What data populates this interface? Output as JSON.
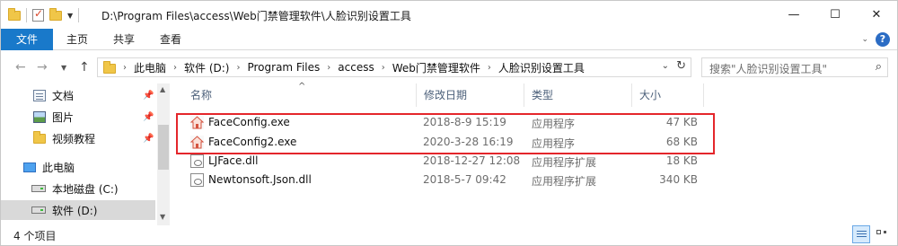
{
  "window": {
    "path_title": "D:\\Program Files\\access\\Web门禁管理软件\\人脸识别设置工具",
    "controls": {
      "minimize": "—",
      "maximize": "☐",
      "close": "✕"
    }
  },
  "ribbon": {
    "tabs": [
      "文件",
      "主页",
      "共享",
      "查看"
    ],
    "help": "?"
  },
  "address": {
    "crumbs": [
      "此电脑",
      "软件 (D:)",
      "Program Files",
      "access",
      "Web门禁管理软件",
      "人脸识别设置工具"
    ],
    "search_placeholder": "搜索\"人脸识别设置工具\""
  },
  "sidebar": {
    "items": [
      {
        "label": "文档",
        "icon": "document-icon",
        "pinned": true
      },
      {
        "label": "图片",
        "icon": "picture-icon",
        "pinned": true
      },
      {
        "label": "视频教程",
        "icon": "folder-icon",
        "pinned": true
      },
      {
        "label": "此电脑",
        "icon": "computer-icon",
        "pinned": false
      },
      {
        "label": "本地磁盘 (C:)",
        "icon": "drive-icon",
        "pinned": false
      },
      {
        "label": "软件 (D:)",
        "icon": "drive-icon",
        "pinned": false,
        "selected": true
      }
    ]
  },
  "columns": {
    "name": "名称",
    "date": "修改日期",
    "type": "类型",
    "size": "大小"
  },
  "files": [
    {
      "name": "FaceConfig.exe",
      "date": "2018-8-9 15:19",
      "type": "应用程序",
      "size": "47 KB",
      "icon": "exe-icon"
    },
    {
      "name": "FaceConfig2.exe",
      "date": "2020-3-28 16:19",
      "type": "应用程序",
      "size": "68 KB",
      "icon": "exe-icon"
    },
    {
      "name": "LJFace.dll",
      "date": "2018-12-27 12:08",
      "type": "应用程序扩展",
      "size": "18 KB",
      "icon": "dll-icon"
    },
    {
      "name": "Newtonsoft.Json.dll",
      "date": "2018-5-7 09:42",
      "type": "应用程序扩展",
      "size": "340 KB",
      "icon": "dll-icon"
    }
  ],
  "status": {
    "item_count": "4 个项目"
  },
  "colors": {
    "accent": "#1979ca",
    "highlight_border": "#e4262b",
    "selection": "#d9d9d9"
  }
}
